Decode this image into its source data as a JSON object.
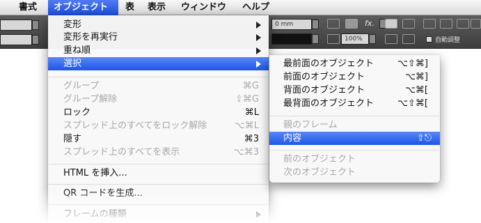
{
  "menubar": {
    "items": [
      {
        "label": "書式"
      },
      {
        "label": "オブジェクト"
      },
      {
        "label": "表"
      },
      {
        "label": "表示"
      },
      {
        "label": "ウィンドウ"
      },
      {
        "label": "ヘルプ"
      }
    ]
  },
  "toolbar": {
    "field_value": "0 mm",
    "zoom_value": "100%",
    "fx_label": "fx.",
    "autofit_label": "自動調整"
  },
  "object_menu": {
    "items": [
      {
        "label": "変形"
      },
      {
        "label": "変形を再実行"
      },
      {
        "label": "重ね順"
      },
      {
        "label": "選択"
      },
      {
        "label": "グループ",
        "shortcut": "⌘G"
      },
      {
        "label": "グループ解除",
        "shortcut": "⇧⌘G"
      },
      {
        "label": "ロック",
        "shortcut": "⌘L"
      },
      {
        "label": "スプレッド上のすべてをロック解除",
        "shortcut": "⌥⌘L"
      },
      {
        "label": "隠す",
        "shortcut": "⌘3"
      },
      {
        "label": "スプレッド上のすべてを表示",
        "shortcut": "⌥⌘3"
      },
      {
        "label": "HTML を挿入..."
      },
      {
        "label": "QR コードを生成..."
      },
      {
        "label": "フレームの種類"
      }
    ]
  },
  "select_submenu": {
    "items": [
      {
        "label": "最前面のオブジェクト",
        "shortcut": "⌥⇧⌘]"
      },
      {
        "label": "前面のオブジェクト",
        "shortcut": "⌥⌘]"
      },
      {
        "label": "背面のオブジェクト",
        "shortcut": "⌥⌘["
      },
      {
        "label": "最背面のオブジェクト",
        "shortcut": "⌥⇧⌘["
      },
      {
        "label": "親のフレーム"
      },
      {
        "label": "内容",
        "shortcut": "⇧⎋"
      },
      {
        "label": "前のオブジェクト"
      },
      {
        "label": "次のオブジェクト"
      }
    ]
  }
}
